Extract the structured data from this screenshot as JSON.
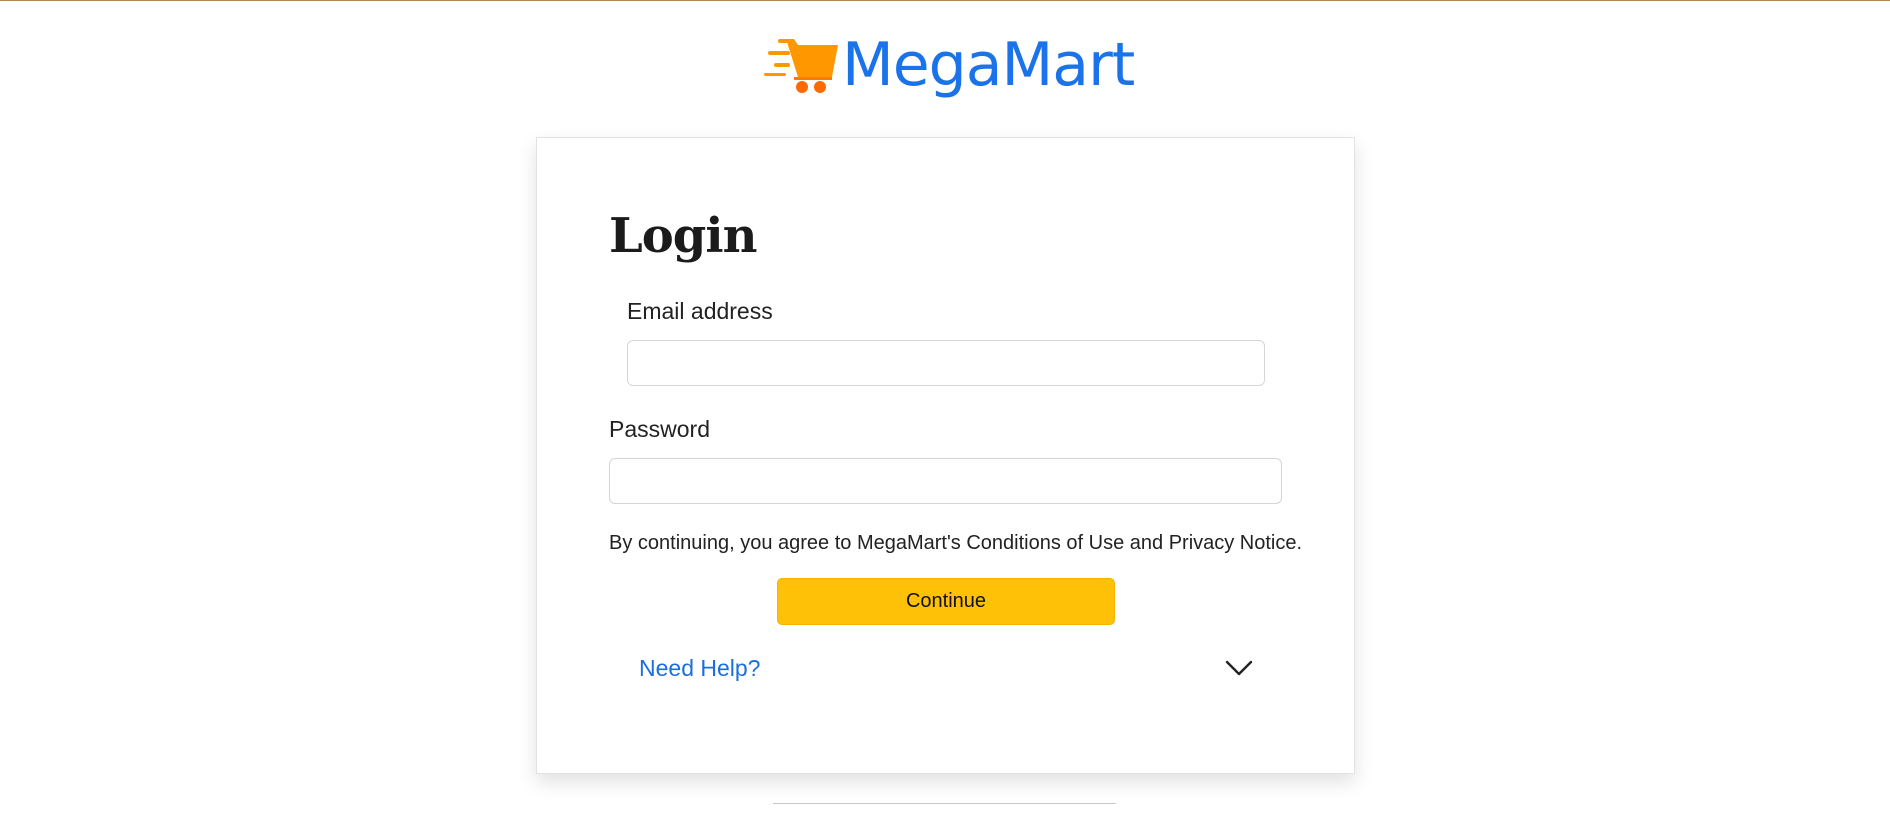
{
  "brand": {
    "name": "MegaMart",
    "logo_icon": "shopping-cart-icon",
    "color": "#1a73e8",
    "cart_color": "#ff9800"
  },
  "login": {
    "title": "Login",
    "email_label": "Email address",
    "email_value": "",
    "password_label": "Password",
    "password_value": "",
    "terms": "By continuing, you agree to MegaMart's Conditions of Use and Privacy Notice.",
    "continue_label": "Continue",
    "continue_color": "#ffc107",
    "help_label": "Need Help?",
    "help_icon": "chevron-down-icon",
    "link_color": "#1a6fdc"
  }
}
